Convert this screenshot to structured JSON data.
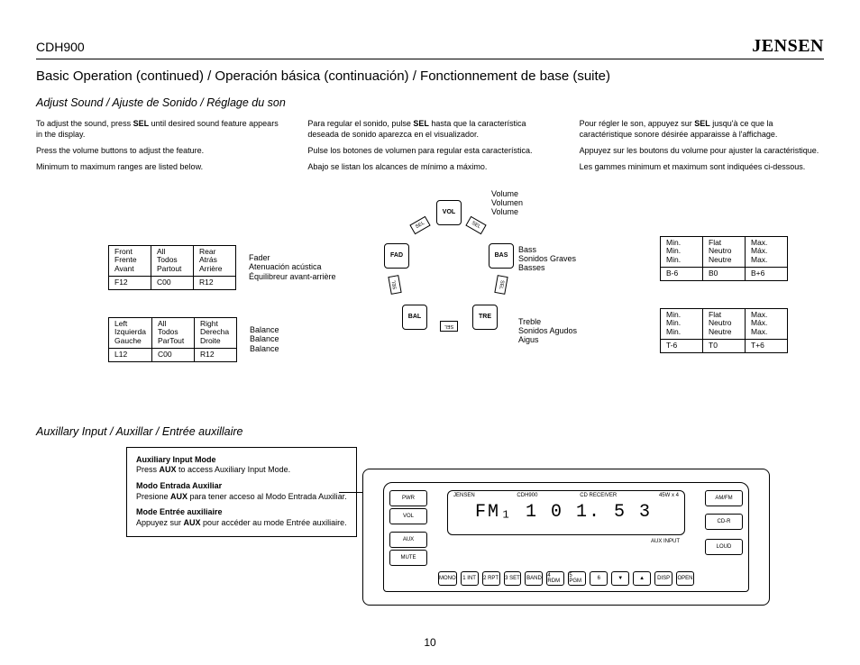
{
  "header": {
    "model": "CDH900",
    "brand": "JENSEN"
  },
  "title": "Basic Operation (continued) / Operación básica (continuación) / Fonctionnement de base (suite)",
  "adjust": {
    "heading": "Adjust Sound / Ajuste de Sonido / Réglage du son",
    "en": {
      "p1a": "To adjust the sound, press ",
      "p1b": "SEL",
      "p1c": " until desired sound feature appears in the display.",
      "p2": "Press the volume buttons to adjust the feature.",
      "p3": "Minimum to maximum ranges are listed below."
    },
    "es": {
      "p1a": "Para regular el sonido, pulse ",
      "p1b": "SEL",
      "p1c": " hasta que la característica deseada de sonido aparezca en el visualizador.",
      "p2": "Pulse los botones de volumen para regular esta característica.",
      "p3": "Abajo se listan los alcances de mínimo a máximo."
    },
    "fr": {
      "p1a": "Pour régler le son, appuyez sur ",
      "p1b": "SEL",
      "p1c": " jusqu'à ce que la caractéristique sonore désirée apparaisse à l'affichage.",
      "p2": "Appuyez sur les boutons du volume pour ajuster la caractéristique.",
      "p3": "Les gammes minimum et maximum sont indiquées ci-dessous."
    }
  },
  "volume": {
    "l1": "Volume",
    "l2": "Volumen",
    "l3": "Volume"
  },
  "fader": {
    "name": {
      "l1": "Fader",
      "l2": "Atenuación acústica",
      "l3": "Équilibreur avant-arrière"
    },
    "h": {
      "c1a": "Front",
      "c1b": "Frente",
      "c1c": "Avant",
      "c2a": "All",
      "c2b": "Todos",
      "c2c": "Partout",
      "c3a": "Rear",
      "c3b": "Atrás",
      "c3c": "Arrière"
    },
    "v": {
      "c1": "F12",
      "c2": "C00",
      "c3": "R12"
    },
    "chip": "FAD"
  },
  "balance": {
    "name": {
      "l1": "Balance",
      "l2": "Balance",
      "l3": "Balance"
    },
    "h": {
      "c1a": "Left",
      "c1b": "Izquierda",
      "c1c": "Gauche",
      "c2a": "All",
      "c2b": "Todos",
      "c2c": "ParTout",
      "c3a": "Right",
      "c3b": "Derecha",
      "c3c": "Droite"
    },
    "v": {
      "c1": "L12",
      "c2": "C00",
      "c3": "R12"
    },
    "chip": "BAL"
  },
  "bass": {
    "name": {
      "l1": "Bass",
      "l2": "Sonidos Graves",
      "l3": "Basses"
    },
    "h": {
      "c1a": "Min.",
      "c1b": "Min.",
      "c1c": "Min.",
      "c2a": "Flat",
      "c2b": "Neutro",
      "c2c": "Neutre",
      "c3a": "Max.",
      "c3b": "Máx.",
      "c3c": "Max."
    },
    "v": {
      "c1": "B-6",
      "c2": "B0",
      "c3": "B+6"
    },
    "chip": "BAS"
  },
  "treble": {
    "name": {
      "l1": "Treble",
      "l2": "Sonidos Agudos",
      "l3": "Aigus"
    },
    "h": {
      "c1a": "Min.",
      "c1b": "Min.",
      "c1c": "Min.",
      "c2a": "Flat",
      "c2b": "Neutro",
      "c2c": "Neutre",
      "c3a": "Max.",
      "c3b": "Máx.",
      "c3c": "Max."
    },
    "v": {
      "c1": "T-6",
      "c2": "T0",
      "c3": "T+6"
    },
    "chip": "TRE"
  },
  "sel": "SEL",
  "vchip": "VOL",
  "aux": {
    "heading": "Auxillary Input / Auxillar / Entrée auxillaire",
    "en": {
      "t": "Auxiliary Input Mode",
      "a": "Press ",
      "b": "AUX",
      "c": " to access Auxiliary Input Mode."
    },
    "es": {
      "t": "Modo Entrada Auxiliar",
      "a": "Presione ",
      "b": "AUX",
      "c": " para tener acceso al Modo Entrada Auxiliar."
    },
    "fr": {
      "t": "Mode Entrée auxiliaire",
      "a": "Appuyez sur ",
      "b": "AUX",
      "c": " pour accéder au mode Entrée auxiliaire."
    }
  },
  "radio": {
    "brand": "JENSEN",
    "model": "CDH900",
    "cd": "CD RECEIVER",
    "watt": "45W x 4",
    "display": "FM₁  1 0 1. 5   3",
    "auxjack": "AUX INPUT",
    "left": {
      "pwr": "PWR",
      "vol": "VOL",
      "aux": "AUX",
      "mute": "MUTE"
    },
    "right": {
      "ampx": "AM/FM",
      "cdr": "CD-R",
      "loud": "LOUD"
    },
    "btn": {
      "mono": "MONO",
      "b1": "1 INT",
      "b2": "2 RPT",
      "b3": "3 SET",
      "b4": "4 RDM",
      "b5": "5 PGM",
      "b6": "6",
      "band": "BAND",
      "up": "▲",
      "dn": "▼",
      "disp": "DISP",
      "open": "OPEN"
    }
  },
  "pageno": "10"
}
